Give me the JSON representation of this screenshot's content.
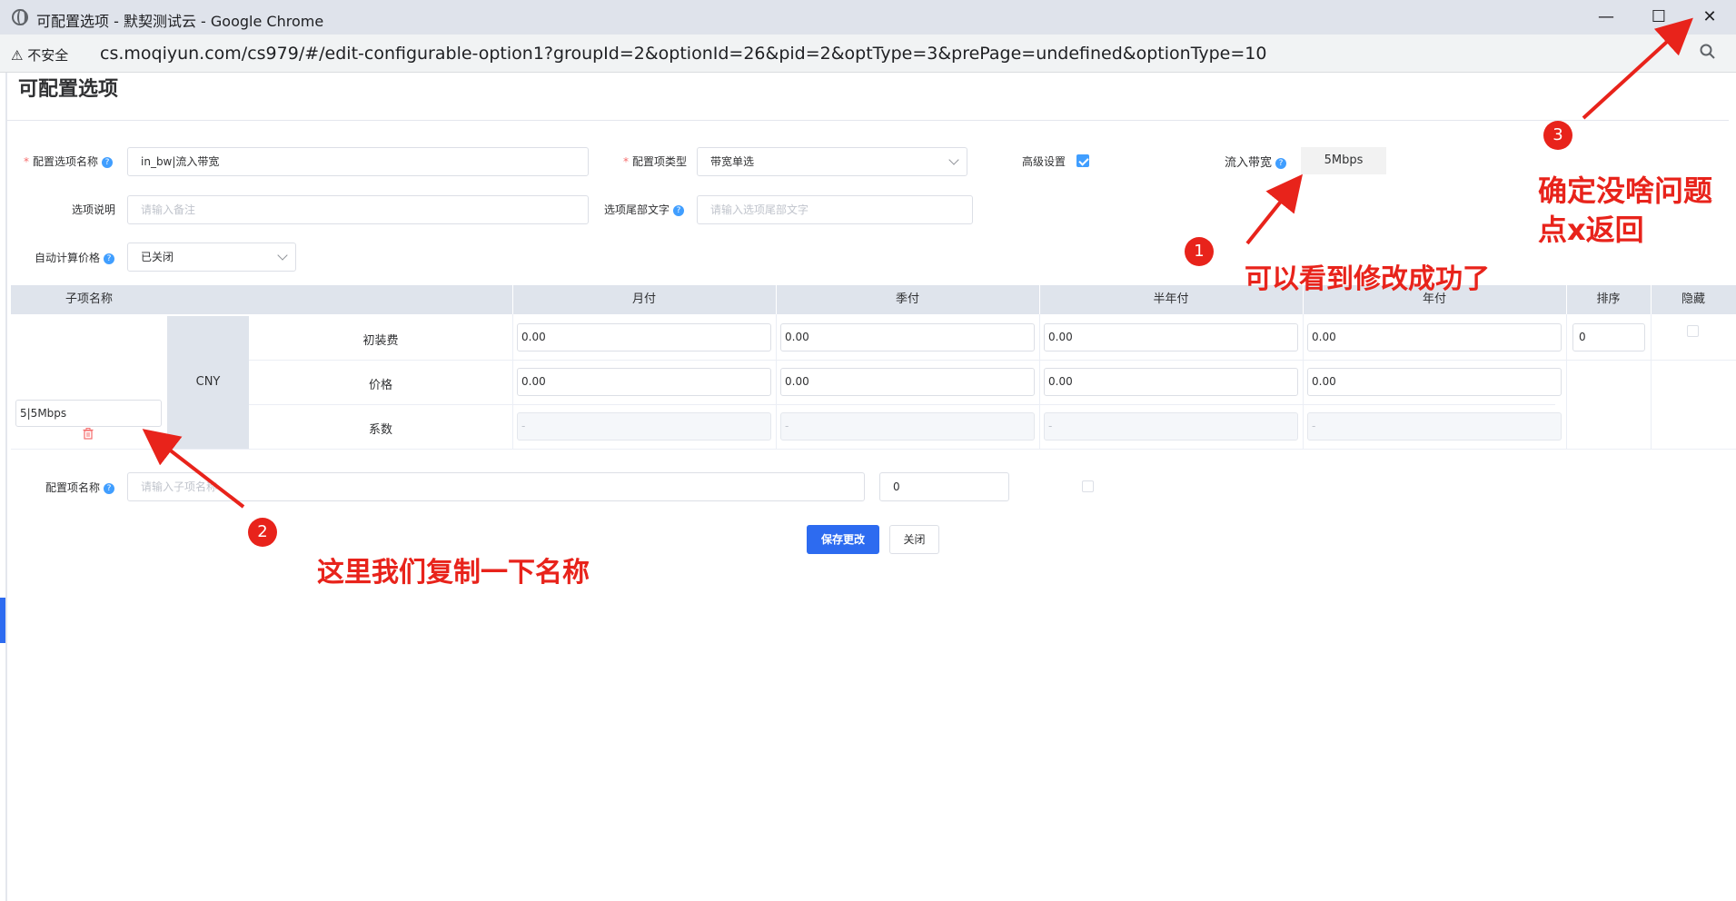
{
  "window": {
    "title": "可配置选项 - 默契测试云 - Google Chrome",
    "security_label": "不安全",
    "url": "cs.moqiyun.com/cs979/#/edit-configurable-option1?groupId=2&optionId=26&pid=2&optType=3&prePage=undefined&optionType=10",
    "minimize": "—",
    "maximize": "☐",
    "close": "✕",
    "zoom_icon": "magnifier-icon"
  },
  "page": {
    "title": "可配置选项"
  },
  "form": {
    "option_name_label": "配置选项名称",
    "option_name_value": "in_bw|流入带宽",
    "option_type_label": "配置项类型",
    "option_type_value": "带宽单选",
    "advanced_label": "高级设置",
    "advanced_checked": true,
    "inbound_bw_label": "流入带宽",
    "inbound_bw_value": "5Mbps",
    "desc_label": "选项说明",
    "desc_placeholder": "请输入备注",
    "suffix_label": "选项尾部文字",
    "suffix_placeholder": "请输入选项尾部文字",
    "auto_price_label": "自动计算价格",
    "auto_price_value": "已关闭"
  },
  "table": {
    "headers": {
      "sub_name": "子项名称",
      "monthly": "月付",
      "quarterly": "季付",
      "semiannual": "半年付",
      "annual": "年付",
      "sort": "排序",
      "hidden": "隐藏"
    },
    "currency": "CNY",
    "sub_item_value": "5|5Mbps",
    "delete_icon": "trash-icon",
    "rows": [
      {
        "label": "初装费",
        "values": [
          "0.00",
          "0.00",
          "0.00",
          "0.00"
        ]
      },
      {
        "label": "价格",
        "values": [
          "0.00",
          "0.00",
          "0.00",
          "0.00"
        ]
      },
      {
        "label": "系数",
        "values": [
          "-",
          "-",
          "-",
          "-"
        ]
      }
    ],
    "sort_value": "0"
  },
  "new_item": {
    "label": "配置项名称",
    "placeholder": "请输入子项名称",
    "sort_value": "0"
  },
  "actions": {
    "save": "保存更改",
    "close": "关闭"
  },
  "annotations": {
    "badge1": "1",
    "badge2": "2",
    "badge3": "3",
    "text1": "可以看到修改成功了",
    "text2": "这里我们复制一下名称",
    "text3_line1": "确定没啥问题",
    "text3_line2": "点x返回"
  },
  "colors": {
    "annotation_red": "#e8231b",
    "primary_blue": "#2d6bf0",
    "header_bg": "#dfe4ec"
  }
}
